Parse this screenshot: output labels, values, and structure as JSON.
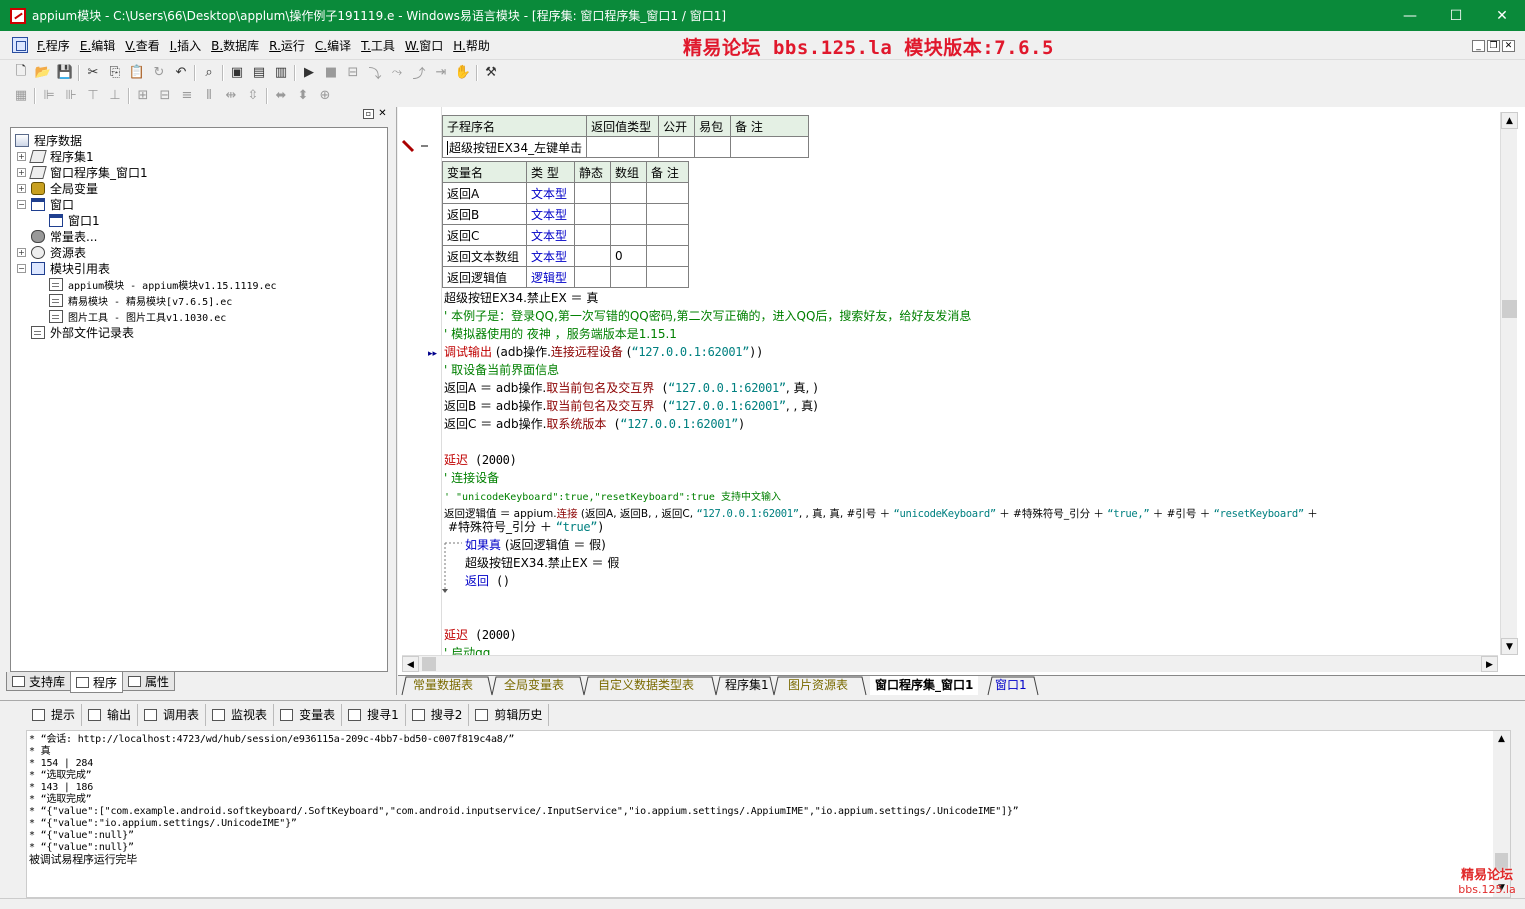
{
  "window": {
    "title": "appium模块 - C:\\Users\\66\\Desktop\\applum\\操作例子191119.e - Windows易语言模块 - [程序集: 窗口程序集_窗口1 / 窗口1]",
    "minimize": "—",
    "maximize": "☐",
    "close": "✕"
  },
  "menu": [
    "F.程序",
    "E.编辑",
    "V.查看",
    "I.插入",
    "B.数据库",
    "R.运行",
    "C.编译",
    "T.工具",
    "W.窗口",
    "H.帮助"
  ],
  "banner": "精易论坛 bbs.125.la 模块版本:7.6.5",
  "tree": {
    "root": "程序数据",
    "items": [
      {
        "label": "程序集1",
        "icon": "set-icon",
        "level": 1,
        "expander": "+"
      },
      {
        "label": "窗口程序集_窗口1",
        "icon": "set-icon",
        "level": 1,
        "expander": "+"
      },
      {
        "label": "全局变量",
        "icon": "global-var-icon",
        "level": 1,
        "expander": "+"
      },
      {
        "label": "窗口",
        "icon": "window-icon",
        "level": 1,
        "expander": "−"
      },
      {
        "label": "窗口1",
        "icon": "window-icon",
        "level": 2,
        "expander": ""
      },
      {
        "label": "常量表...",
        "icon": "const-icon",
        "level": 1,
        "expander": ""
      },
      {
        "label": "资源表",
        "icon": "resource-icon",
        "level": 1,
        "expander": "+"
      },
      {
        "label": "模块引用表",
        "icon": "module-icon",
        "level": 1,
        "expander": "−"
      },
      {
        "label": "appium模块 - appium模块v1.15.1119.ec",
        "icon": "doc-icon",
        "level": 2,
        "expander": ""
      },
      {
        "label": "精易模块 - 精易模块[v7.6.5].ec",
        "icon": "doc-icon",
        "level": 2,
        "expander": ""
      },
      {
        "label": "图片工具 - 图片工具v1.1030.ec",
        "icon": "doc-icon",
        "level": 2,
        "expander": ""
      },
      {
        "label": "外部文件记录表",
        "icon": "doc-icon",
        "level": 1,
        "expander": ""
      }
    ]
  },
  "left_tabs": [
    "支持库",
    "程序",
    "属性"
  ],
  "sub_table": {
    "headers": [
      "子程序名",
      "返回值类型",
      "公开",
      "易包",
      "备 注"
    ],
    "row": [
      "超级按钮EX34_左键单击",
      "",
      "",
      "",
      ""
    ]
  },
  "var_table": {
    "headers": [
      "变量名",
      "类 型",
      "静态",
      "数组",
      "备 注"
    ],
    "rows": [
      [
        "返回A",
        "文本型",
        "",
        "",
        ""
      ],
      [
        "返回B",
        "文本型",
        "",
        "",
        ""
      ],
      [
        "返回C",
        "文本型",
        "",
        "",
        ""
      ],
      [
        "返回文本数组",
        "文本型",
        "",
        "0",
        ""
      ],
      [
        "返回逻辑值",
        "逻辑型",
        "",
        "",
        ""
      ]
    ]
  },
  "code": {
    "l1": "超级按钮EX34.禁止EX ＝ 真",
    "l2": "' 本例子是：登录QQ,第一次写错的QQ密码,第二次写正确的，进入QQ后，搜索好友，给好友发消息",
    "l3": "' 模拟器使用的 夜神 ，服务端版本是1.15.1",
    "l4a": "调试输出",
    "l4b": " (adb操作.",
    "l4c": "连接远程设备",
    "l4d": " (",
    "l4e": "“127.0.0.1:62001”",
    "l4f": "))",
    "l5": "' 取设备当前界面信息",
    "l6a": "返回A ＝ adb操作.",
    "l6b": "取当前包名及交互界",
    "l6c": " (",
    "l6d": "“127.0.0.1:62001”",
    "l6e": ", 真, )",
    "l7a": "返回B ＝ adb操作.",
    "l7b": "取当前包名及交互界",
    "l7c": " (",
    "l7d": "“127.0.0.1:62001”",
    "l7e": ", , 真)",
    "l8a": "返回C ＝ adb操作.",
    "l8b": "取系统版本",
    "l8c": " (",
    "l8d": "“127.0.0.1:62001”",
    "l8e": ")",
    "l9a": "延迟",
    "l9b": " (2000)",
    "l10": "' 连接设备",
    "l11": "' \"unicodeKeyboard\":true,\"resetKeyboard\":true 支持中文输入",
    "l12a": "返回逻辑值 ＝ appium.",
    "l12b": "连接",
    "l12c": " (返回A, 返回B, , 返回C, ",
    "l12d": "“127.0.0.1:62001”",
    "l12e": ", , 真, 真, #引号 ＋ ",
    "l12f": "“unicodeKeyboard”",
    "l12g": " ＋ #特殊符号_引分 ＋ ",
    "l12h": "“true,”",
    "l12i": " ＋ #引号 ＋ ",
    "l12j": "“resetKeyboard”",
    "l12k": " ＋",
    "l13a": "#特殊符号_引分 ＋ ",
    "l13b": "“true”",
    "l13c": ")",
    "l14a": "如果真",
    "l14b": " (返回逻辑值 ＝ 假)",
    "l15": "超级按钮EX34.禁止EX ＝ 假",
    "l16a": "返回",
    "l16b": " ()",
    "l17a": "延迟",
    "l17b": " (2000)",
    "l18": "' 启动qq"
  },
  "editor_tabs": [
    "常量数据表",
    "全局变量表",
    "自定义数据类型表",
    "程序集1",
    "图片资源表",
    "窗口程序集_窗口1",
    "窗口1"
  ],
  "bottom_tabs": [
    "提示",
    "输出",
    "调用表",
    "监视表",
    "变量表",
    "搜寻1",
    "搜寻2",
    "剪辑历史"
  ],
  "output": [
    "* “会话: http://localhost:4723/wd/hub/session/e936115a-209c-4bb7-bd50-c007f819c4a8/”",
    "* 真",
    "* 154 | 284",
    "* “选取完成”",
    "* 143 | 186",
    "* “选取完成”",
    "* “{\"value\":[\"com.example.android.softkeyboard/.SoftKeyboard\",\"com.android.inputservice/.InputService\",\"io.appium.settings/.AppiumIME\",\"io.appium.settings/.UnicodeIME\"]}”",
    "* “{\"value\":\"io.appium.settings/.UnicodeIME\"}”",
    "* “{\"value\":null}”",
    "* “{\"value\":null}”",
    "被调试易程序运行完毕"
  ],
  "watermark": {
    "line1": "精易论坛",
    "line2": "bbs.125.la"
  }
}
